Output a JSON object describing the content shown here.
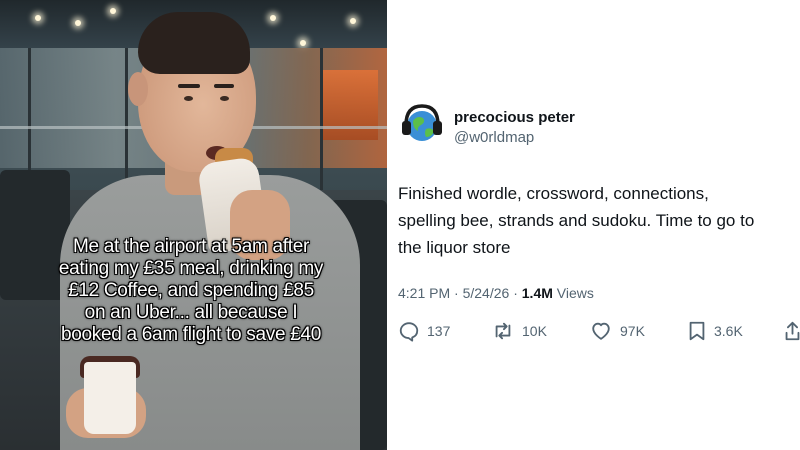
{
  "meme": {
    "caption_lines": [
      "Me at the airport at 5am after",
      "eating my £35 meal, drinking my",
      "£12 Coffee, and spending £85",
      "on an Uber... all because I",
      "booked a 6am flight to save £40"
    ]
  },
  "tweet": {
    "author_name": "precocious peter",
    "author_handle": "@w0rldmap",
    "text_lines": [
      "Finished wordle, crossword, connections,",
      "spelling bee, strands and sudoku. Time to go to",
      "the liquor store"
    ],
    "time": "4:21 PM",
    "separator": "·",
    "date": "5/24/26",
    "views_count": "1.4M",
    "views_label": "Views",
    "replies": "137",
    "reposts": "10K",
    "likes": "97K",
    "bookmarks": "3.6K",
    "icons": {
      "reply": "reply-icon",
      "repost": "repost-icon",
      "like": "heart-icon",
      "bookmark": "bookmark-icon",
      "share": "share-icon"
    },
    "colors": {
      "primary_text": "#0f1419",
      "secondary_text": "#536471"
    }
  }
}
